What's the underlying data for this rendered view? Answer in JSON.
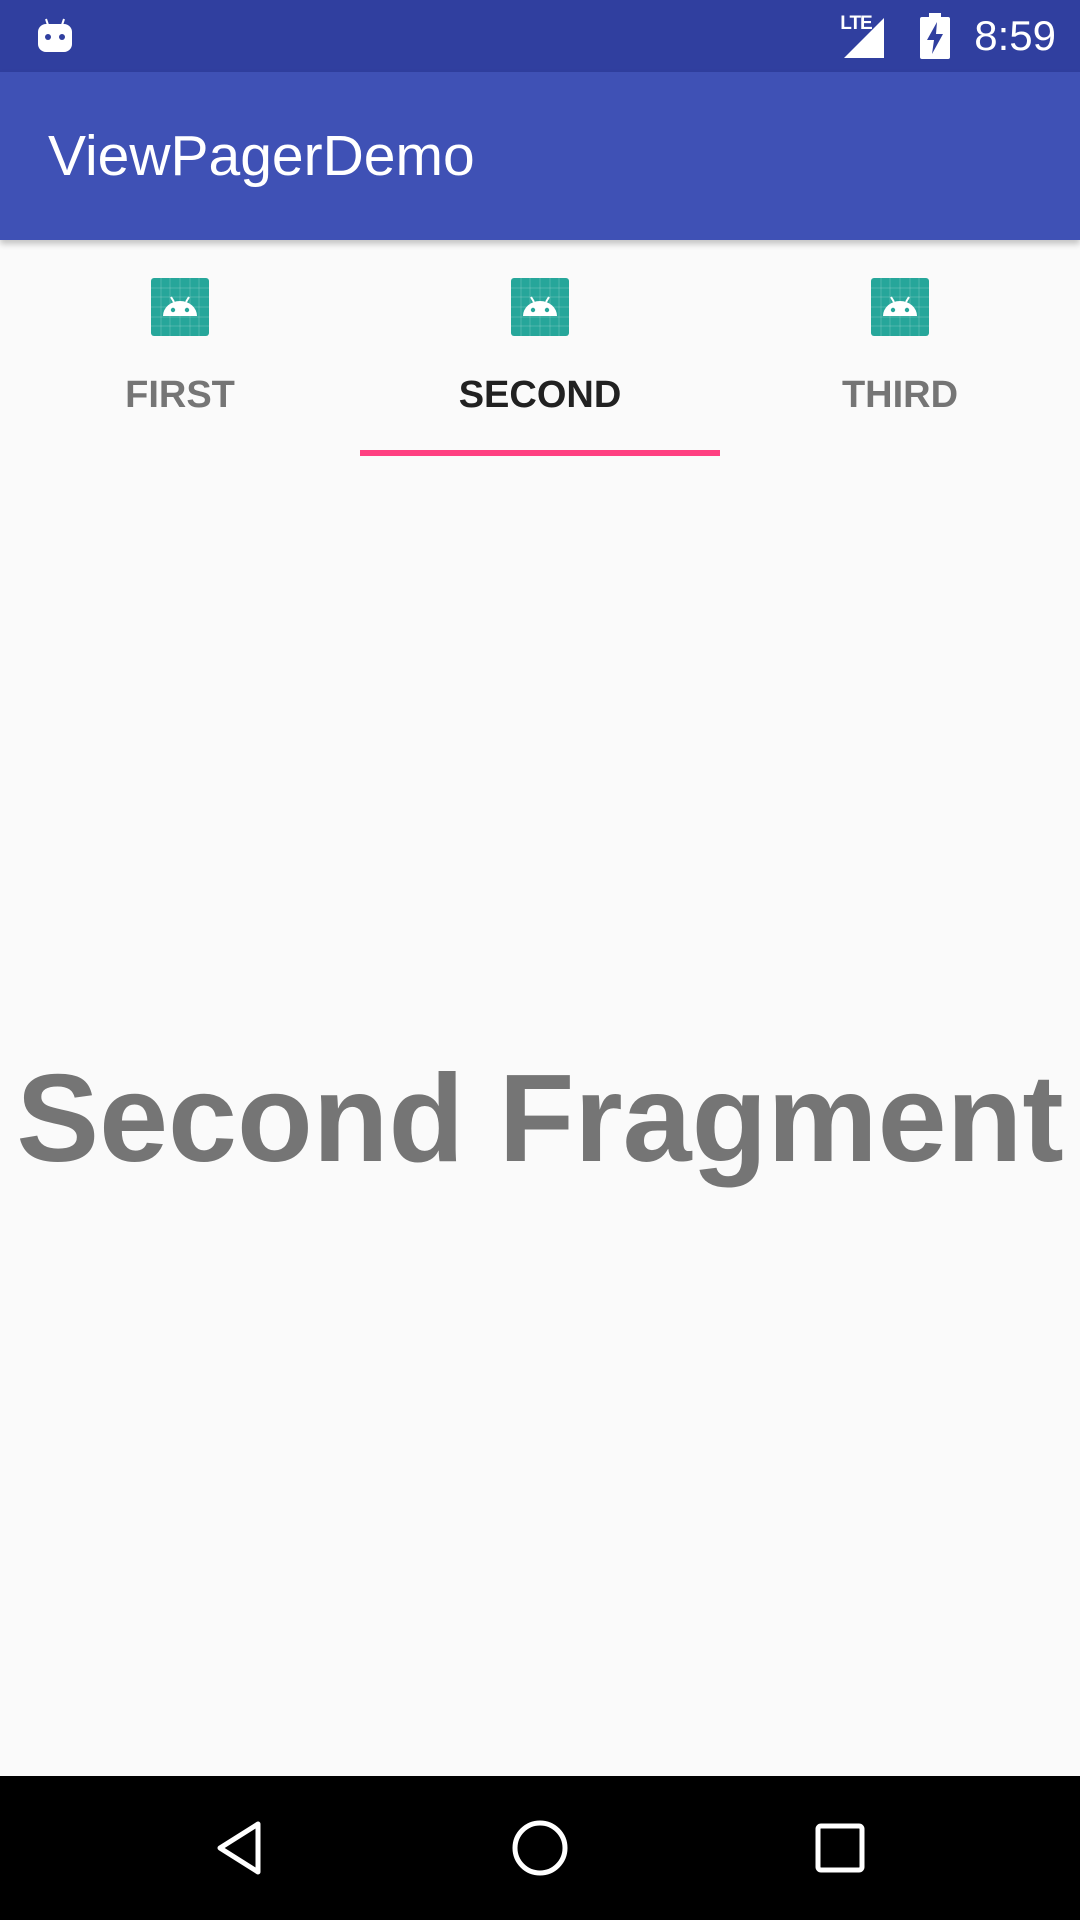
{
  "status_bar": {
    "time": "8:59",
    "network_label": "LTE",
    "notification_icon": "android-robot-icon",
    "signal_icon": "signal-icon",
    "battery_icon": "battery-charging-icon"
  },
  "app_bar": {
    "title": "ViewPagerDemo"
  },
  "tabs": [
    {
      "label": "FIRST",
      "icon": "android-launcher-icon",
      "selected": false
    },
    {
      "label": "SECOND",
      "icon": "android-launcher-icon",
      "selected": true
    },
    {
      "label": "THIRD",
      "icon": "android-launcher-icon",
      "selected": false
    }
  ],
  "content": {
    "text": "Second Fragment"
  },
  "nav_bar": {
    "back_icon": "back-triangle-icon",
    "home_icon": "home-circle-icon",
    "recents_icon": "recents-square-icon"
  },
  "colors": {
    "status_bar": "#303f9f",
    "primary": "#3f51b5",
    "accent": "#ff4081",
    "launcher_icon": "#26a69a",
    "background": "#fafafa"
  }
}
